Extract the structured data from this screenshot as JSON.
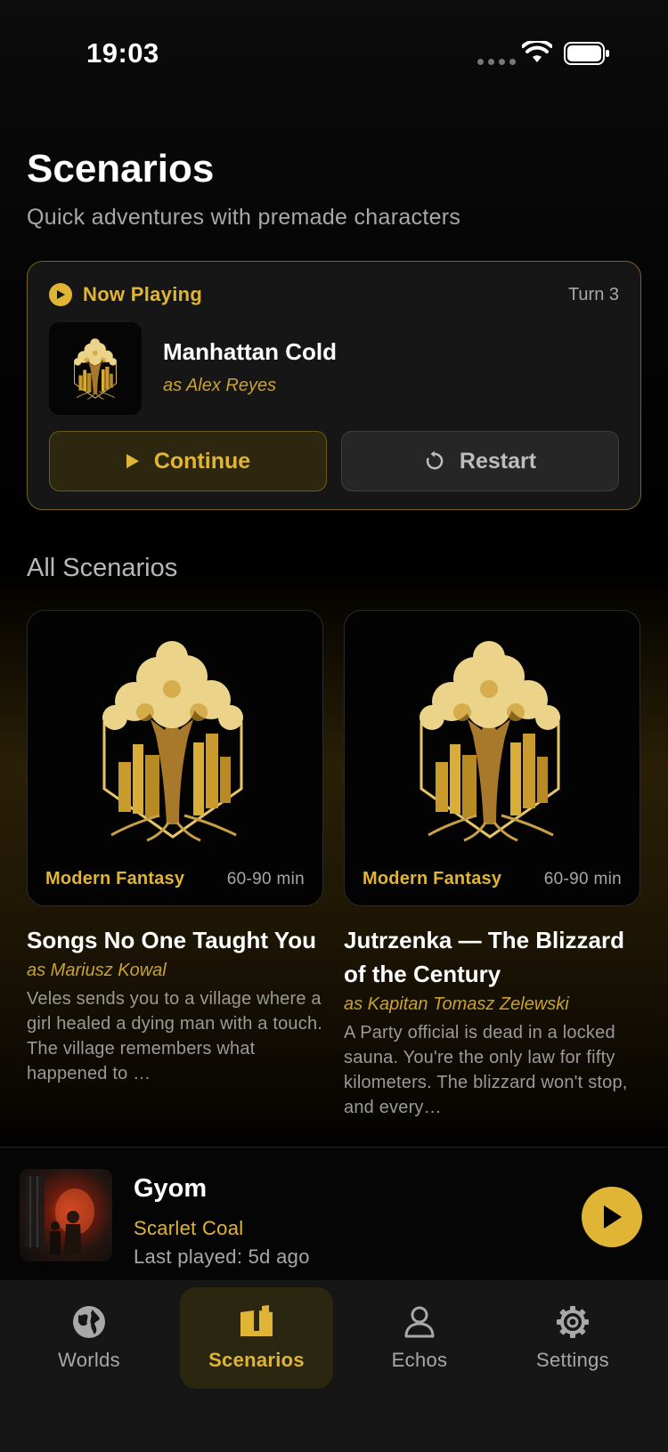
{
  "status": {
    "time": "19:03"
  },
  "header": {
    "title": "Scenarios",
    "subtitle": "Quick adventures with premade characters"
  },
  "now_playing": {
    "label": "Now Playing",
    "turn": "Turn 3",
    "title": "Manhattan Cold",
    "role": "as Alex Reyes",
    "continue_label": "Continue",
    "restart_label": "Restart"
  },
  "section": {
    "title": "All Scenarios"
  },
  "scenarios": [
    {
      "genre": "Modern Fantasy",
      "duration": "60-90 min",
      "title": "Songs No One Taught You",
      "role": "as Mariusz Kowal",
      "description": "Veles sends you to a village where a girl healed a dying man with a touch. The village remembers what happened to …"
    },
    {
      "genre": "Modern Fantasy",
      "duration": "60-90 min",
      "title": "Jutrzenka — The Blizzard of the Century",
      "role": "as Kapitan Tomasz Zelewski",
      "description": "A Party official is dead in a locked sauna. You're the only law for fifty kilometers. The blizzard won't stop, and every…"
    }
  ],
  "mini_player": {
    "title": "Gyom",
    "subtitle": "Scarlet Coal",
    "last_played": "Last played: 5d ago"
  },
  "tabs": [
    {
      "label": "Worlds",
      "icon": "globe-icon",
      "active": false
    },
    {
      "label": "Scenarios",
      "icon": "book-icon",
      "active": true
    },
    {
      "label": "Echos",
      "icon": "person-icon",
      "active": false
    },
    {
      "label": "Settings",
      "icon": "gear-icon",
      "active": false
    }
  ],
  "colors": {
    "accent": "#e0b535",
    "background": "#000000",
    "card": "#161616"
  }
}
